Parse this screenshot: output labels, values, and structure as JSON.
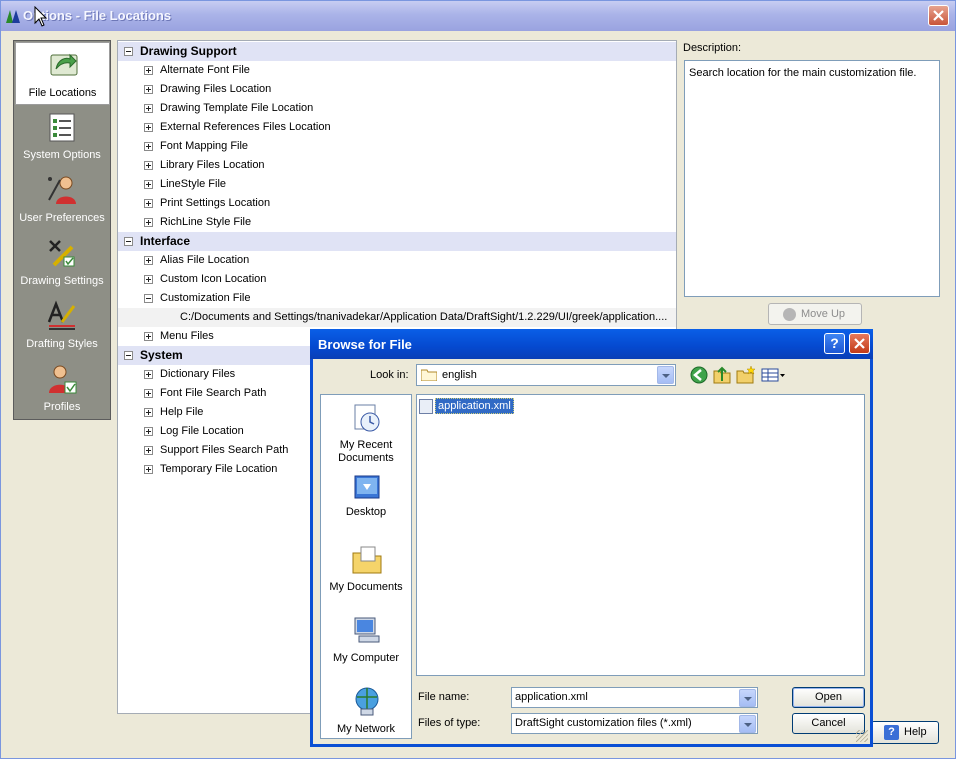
{
  "window": {
    "title": "Options - File Locations"
  },
  "nav": {
    "items": [
      {
        "label": "File Locations",
        "icon": "file-locations-icon",
        "selected": true
      },
      {
        "label": "System Options",
        "icon": "system-options-icon",
        "selected": false
      },
      {
        "label": "User Preferences",
        "icon": "user-preferences-icon",
        "selected": false
      },
      {
        "label": "Drawing Settings",
        "icon": "drawing-settings-icon",
        "selected": false
      },
      {
        "label": "Drafting Styles",
        "icon": "drafting-styles-icon",
        "selected": false
      },
      {
        "label": "Profiles",
        "icon": "profiles-icon",
        "selected": false
      }
    ]
  },
  "tree": {
    "drawing_support": {
      "label": "Drawing Support",
      "items": [
        "Alternate Font File",
        "Drawing Files Location",
        "Drawing Template File Location",
        "External References Files Location",
        "Font Mapping File",
        "Library Files Location",
        "LineStyle File",
        "Print Settings Location",
        "RichLine Style File"
      ]
    },
    "interface": {
      "label": "Interface",
      "items": [
        "Alias File Location",
        "Custom Icon Location",
        "Customization File",
        "Menu Files"
      ],
      "customization_path": "C:/Documents and Settings/tnanivadekar/Application Data/DraftSight/1.2.229/UI/greek/application...."
    },
    "system": {
      "label": "System",
      "items": [
        "Dictionary Files",
        "Font File Search Path",
        "Help File",
        "Log File Location",
        "Support Files Search Path",
        "Temporary File Location"
      ]
    }
  },
  "description": {
    "label": "Description:",
    "text": "Search location for the main customization file."
  },
  "buttons": {
    "move_up": "Move Up",
    "help": "Help"
  },
  "browse": {
    "title": "Browse for File",
    "look_in_label": "Look in:",
    "look_in_value": "english",
    "places": [
      {
        "label": "My Recent Documents",
        "icon": "recent-documents-icon"
      },
      {
        "label": "Desktop",
        "icon": "desktop-icon"
      },
      {
        "label": "My Documents",
        "icon": "my-documents-icon"
      },
      {
        "label": "My Computer",
        "icon": "my-computer-icon"
      },
      {
        "label": "My Network",
        "icon": "my-network-icon"
      }
    ],
    "files": [
      "application.xml"
    ],
    "file_name_label": "File name:",
    "file_name_value": "application.xml",
    "file_type_label": "Files of type:",
    "file_type_value": "DraftSight customization files (*.xml)",
    "open_label": "Open",
    "cancel_label": "Cancel"
  }
}
